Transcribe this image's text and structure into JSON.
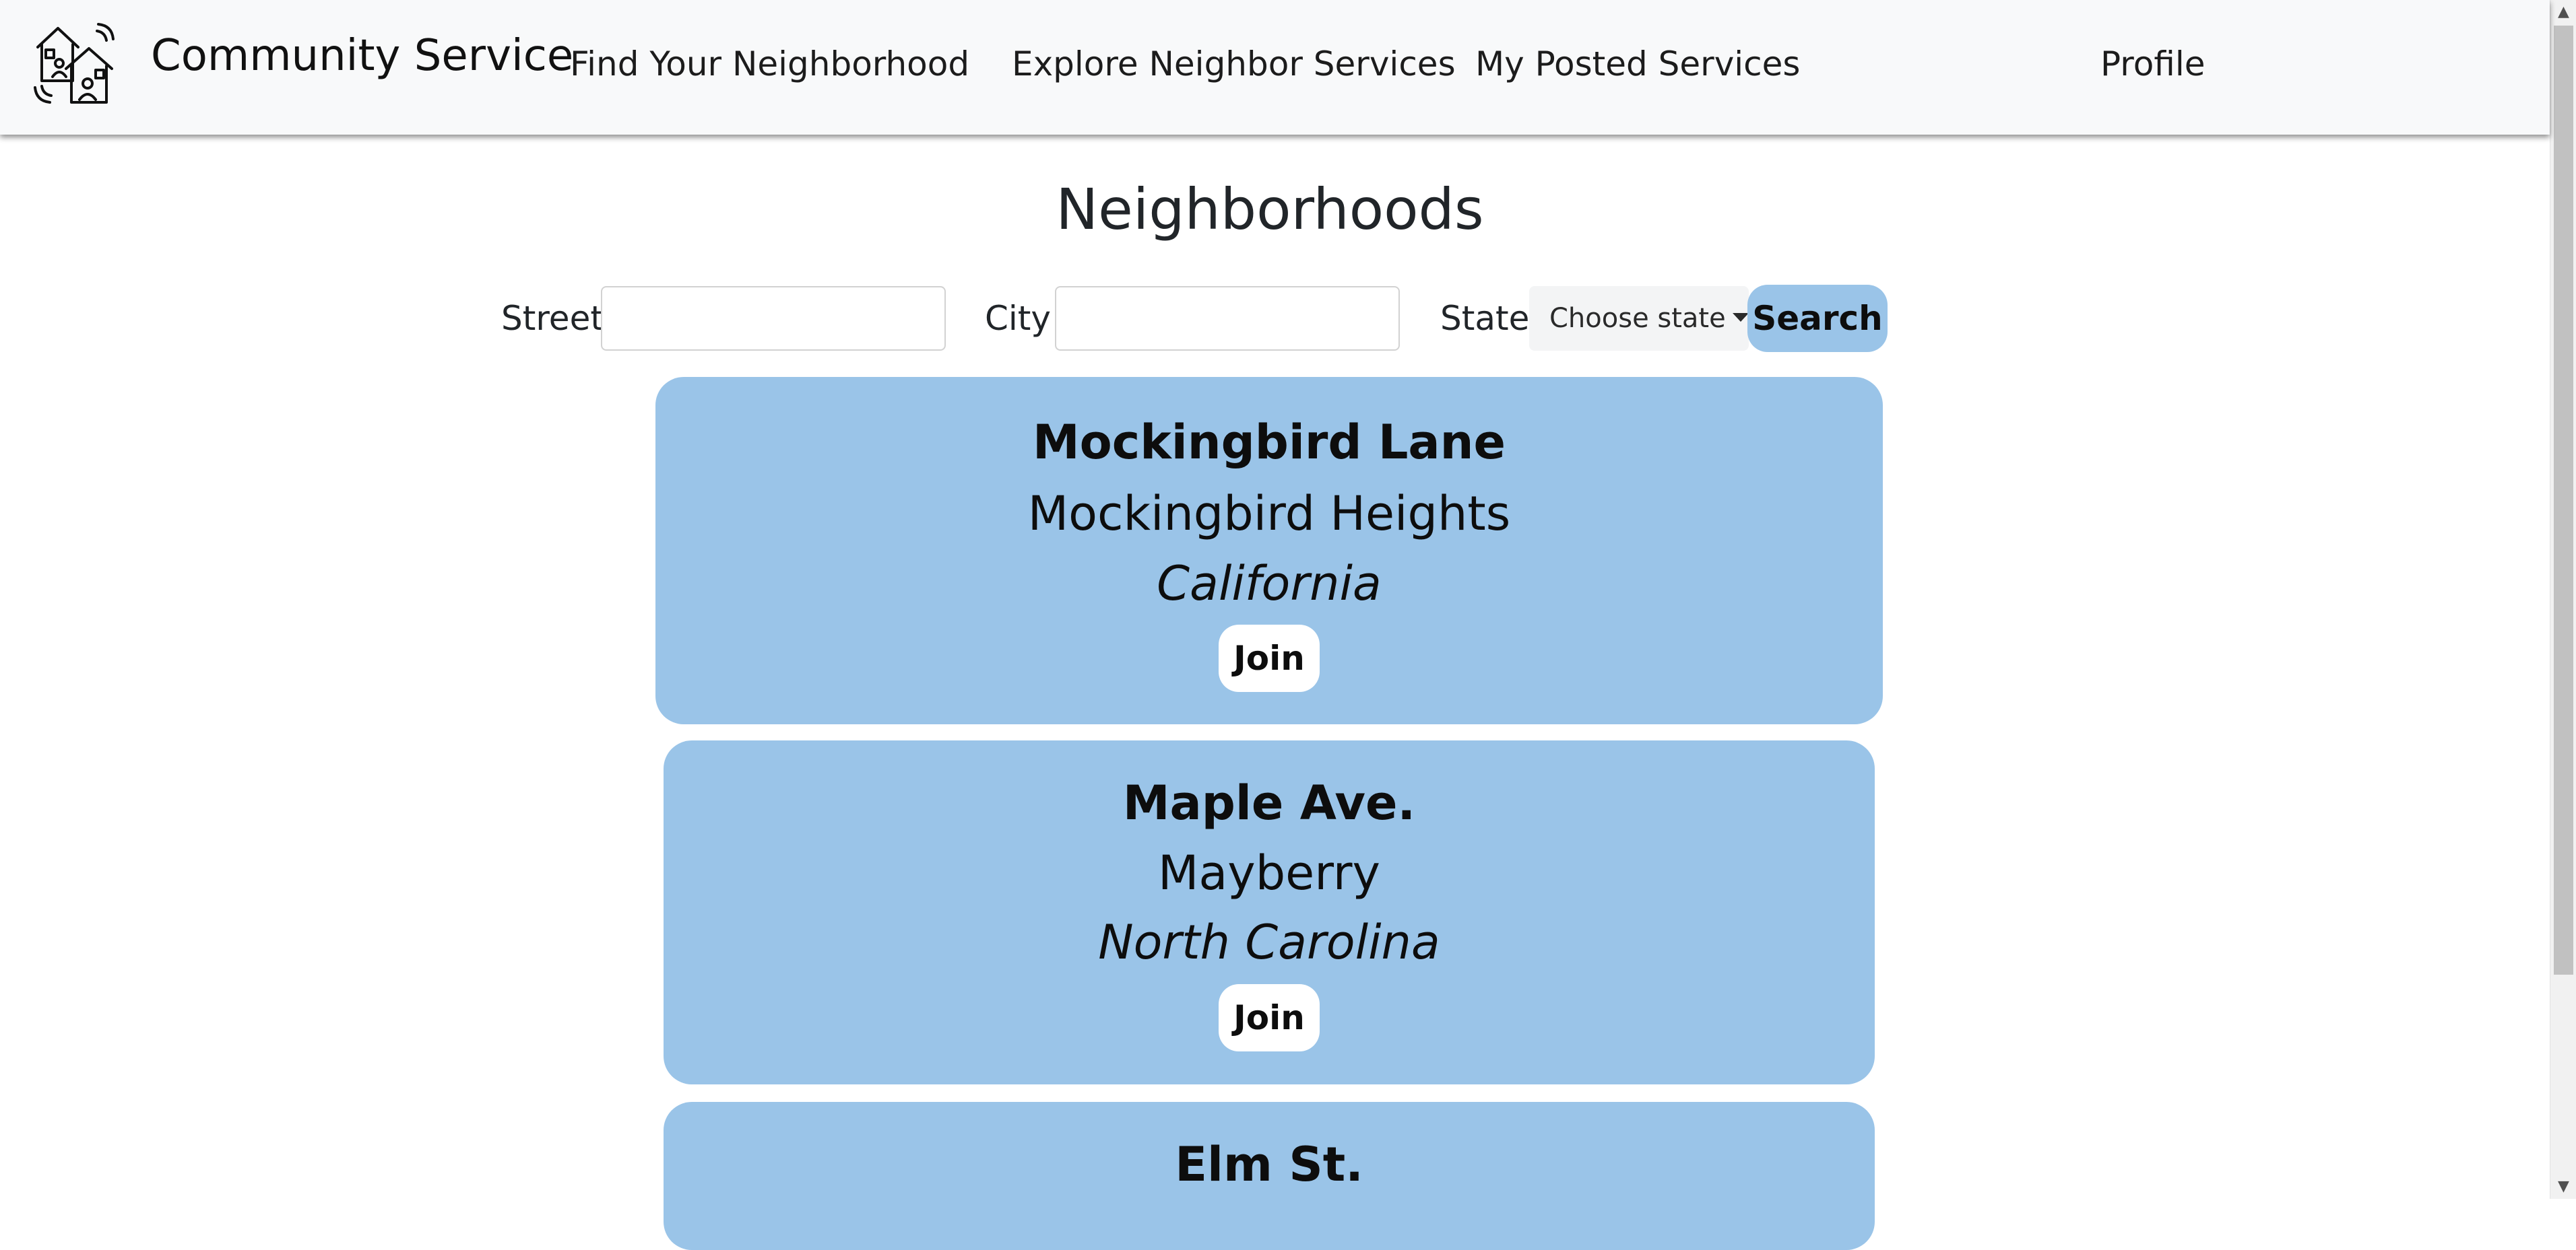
{
  "navbar": {
    "brand": "Community Service",
    "links": {
      "find": "Find Your Neighborhood",
      "explore": "Explore Neighbor Services",
      "posted": "My Posted Services",
      "profile": "Profile"
    }
  },
  "main": {
    "title": "Neighborhoods",
    "search": {
      "street_label": "Street",
      "street_value": "",
      "city_label": "City",
      "city_value": "",
      "state_label": "State",
      "state_selected": "Choose state",
      "search_label": "Search"
    },
    "neighborhoods": [
      {
        "street": "Mockingbird Lane",
        "city": "Mockingbird Heights",
        "state": "California",
        "join_label": "Join"
      },
      {
        "street": "Maple Ave.",
        "city": "Mayberry",
        "state": "North Carolina",
        "join_label": "Join"
      },
      {
        "street": "Elm St."
      }
    ]
  },
  "colors": {
    "navbar_bg": "#f8f9fa",
    "card_bg": "#9ac4e8",
    "button_bg": "#ffffff",
    "search_button_bg": "#9ac4e8"
  },
  "icons": {
    "brand": "community-houses-icon",
    "dropdown": "caret-down-icon",
    "scroll_up": "scroll-up-arrow-icon",
    "scroll_down": "scroll-down-arrow-icon"
  }
}
